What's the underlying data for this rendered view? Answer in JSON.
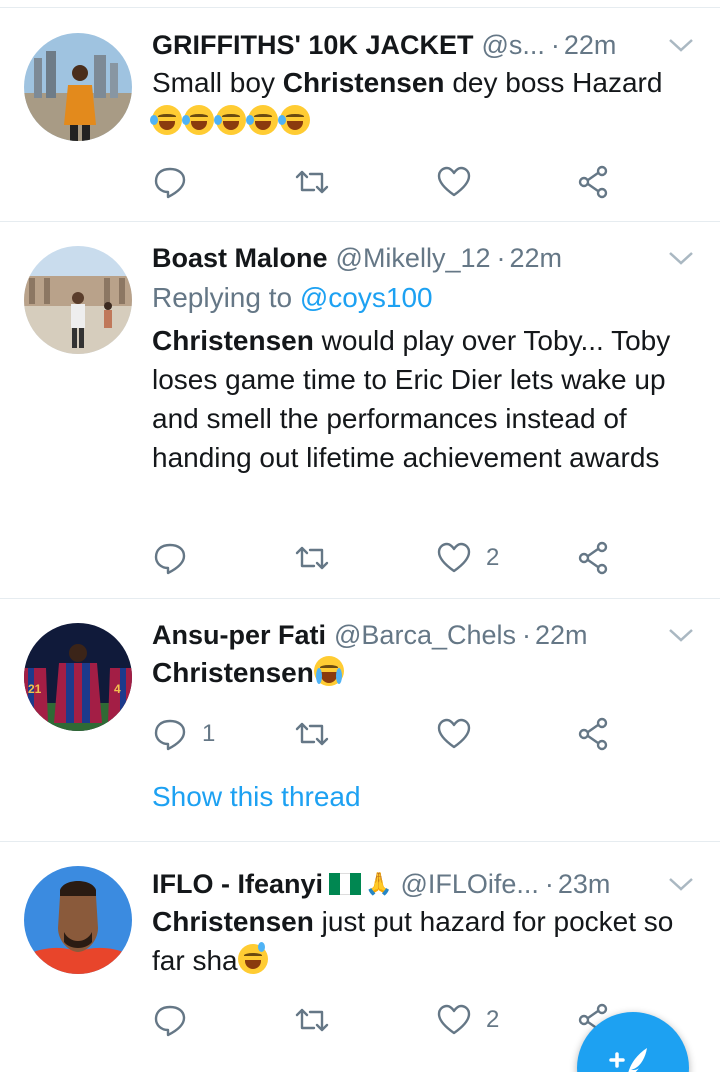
{
  "tweets": [
    {
      "name": "GRIFFITHS' 10K JACKET",
      "handle": "@s...",
      "separator": "·",
      "time": "22m",
      "text_bold": "",
      "text_pre": "Small boy ",
      "text_bold_mid": "Christensen",
      "text_post": " dey boss Hazard",
      "emoji_line": "😹😹😹😹😹",
      "replies": "",
      "likes": ""
    },
    {
      "name": "Boast Malone",
      "handle": "@Mikelly_12",
      "separator": "·",
      "time": "22m",
      "replying_prefix": "Replying to ",
      "replying_handle": "@coys100",
      "text_bold": "Christensen",
      "text_post": " would play over Toby... Toby loses game time to Eric Dier lets wake up and smell the performances instead of handing out lifetime achievement awards",
      "replies": "",
      "likes": "2"
    },
    {
      "name": "Ansu-per Fati",
      "handle": "@Barca_Chels",
      "separator": "·",
      "time": "22m",
      "text_bold": "Christensen",
      "emoji": "😭",
      "replies": "1",
      "likes": "",
      "show_thread": "Show this thread"
    },
    {
      "name": "IFLO - Ifeanyi",
      "handle": "@IFLOife...",
      "separator": "·",
      "time": "23m",
      "text_bold": "Christensen",
      "text_post": " just put hazard for pocket so far sha",
      "emoji": "😅",
      "replies": "",
      "likes": "2"
    }
  ],
  "icons": {
    "reply": "reply-icon",
    "retweet": "retweet-icon",
    "like": "heart-icon",
    "share": "share-icon",
    "more": "chevron-down-icon",
    "compose": "compose-tweet-icon"
  },
  "colors": {
    "accent": "#1da1f2",
    "secondary_text": "#657786",
    "primary_text": "#14171a",
    "divider": "#e6ecf0"
  }
}
